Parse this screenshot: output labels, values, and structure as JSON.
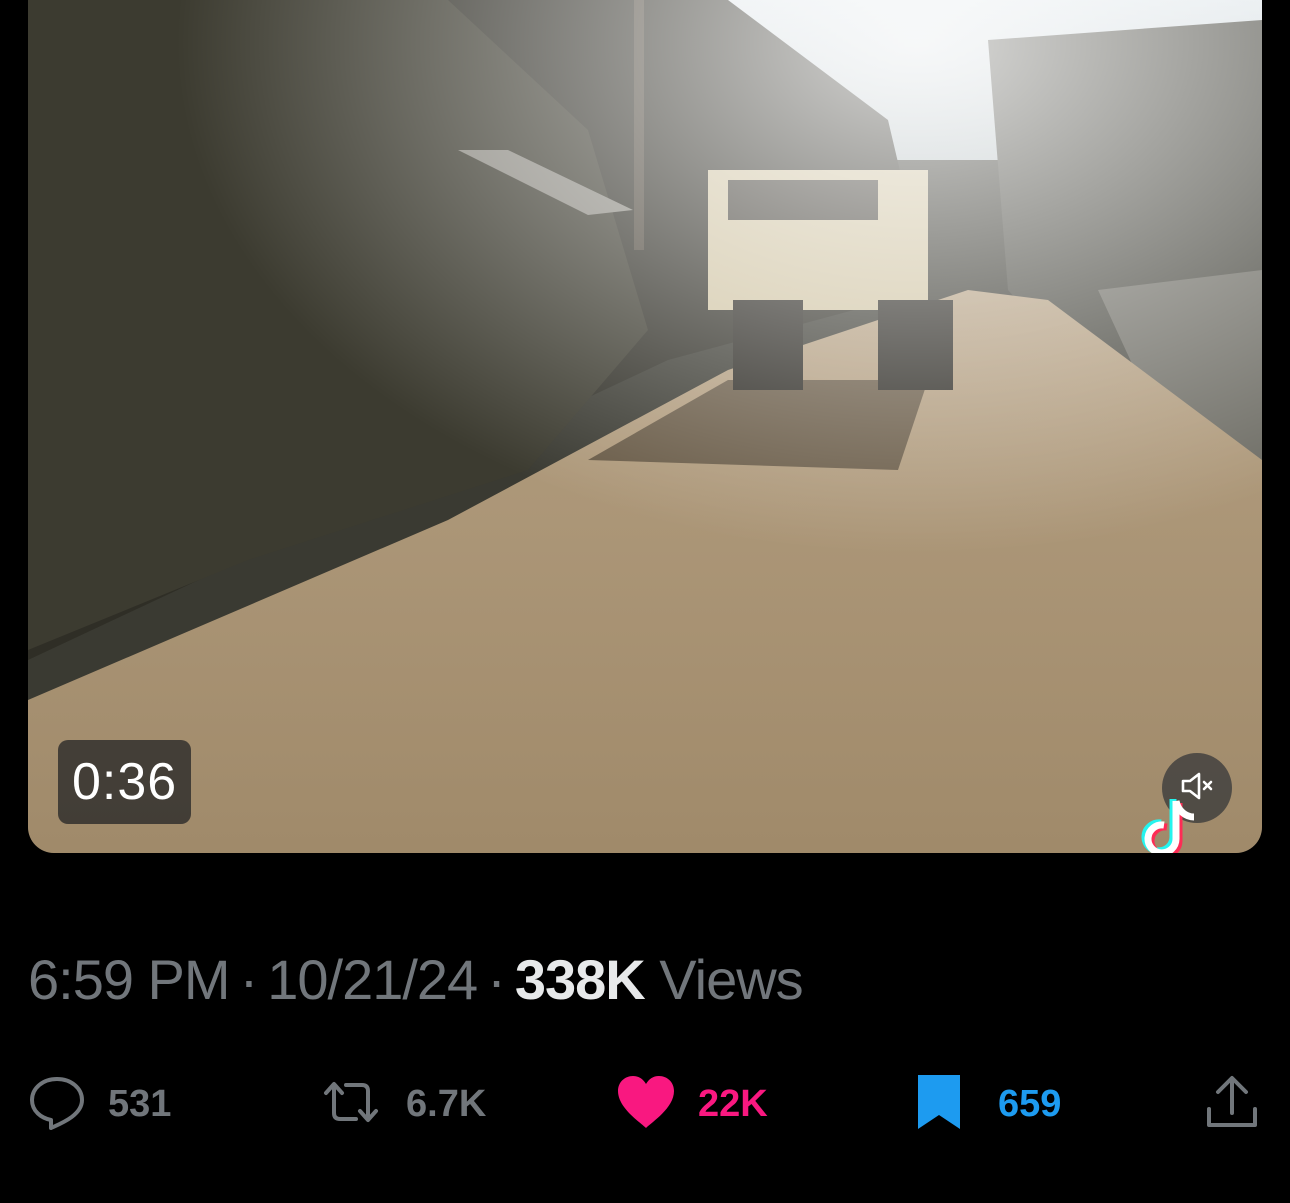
{
  "video": {
    "duration": "0:36",
    "mute_icon": "speaker-muted-icon",
    "watermark_icon": "tiktok-logo-icon"
  },
  "post_meta": {
    "time": "6:59 PM",
    "date": "10/21/24",
    "views_count": "338K",
    "views_label": "Views",
    "separator": "·"
  },
  "actions": {
    "reply": {
      "icon": "reply-bubble-icon",
      "count": "531"
    },
    "repost": {
      "icon": "repost-arrows-icon",
      "count": "6.7K"
    },
    "like": {
      "icon": "heart-icon",
      "count": "22K",
      "active": true,
      "color": "#f91880"
    },
    "bookmark": {
      "icon": "bookmark-icon",
      "count": "659",
      "active": true,
      "color": "#1d9bf0"
    },
    "share": {
      "icon": "share-upload-icon"
    }
  },
  "colors": {
    "background": "#000000",
    "muted_text": "#71767b",
    "primary_text": "#e7e9ea"
  }
}
